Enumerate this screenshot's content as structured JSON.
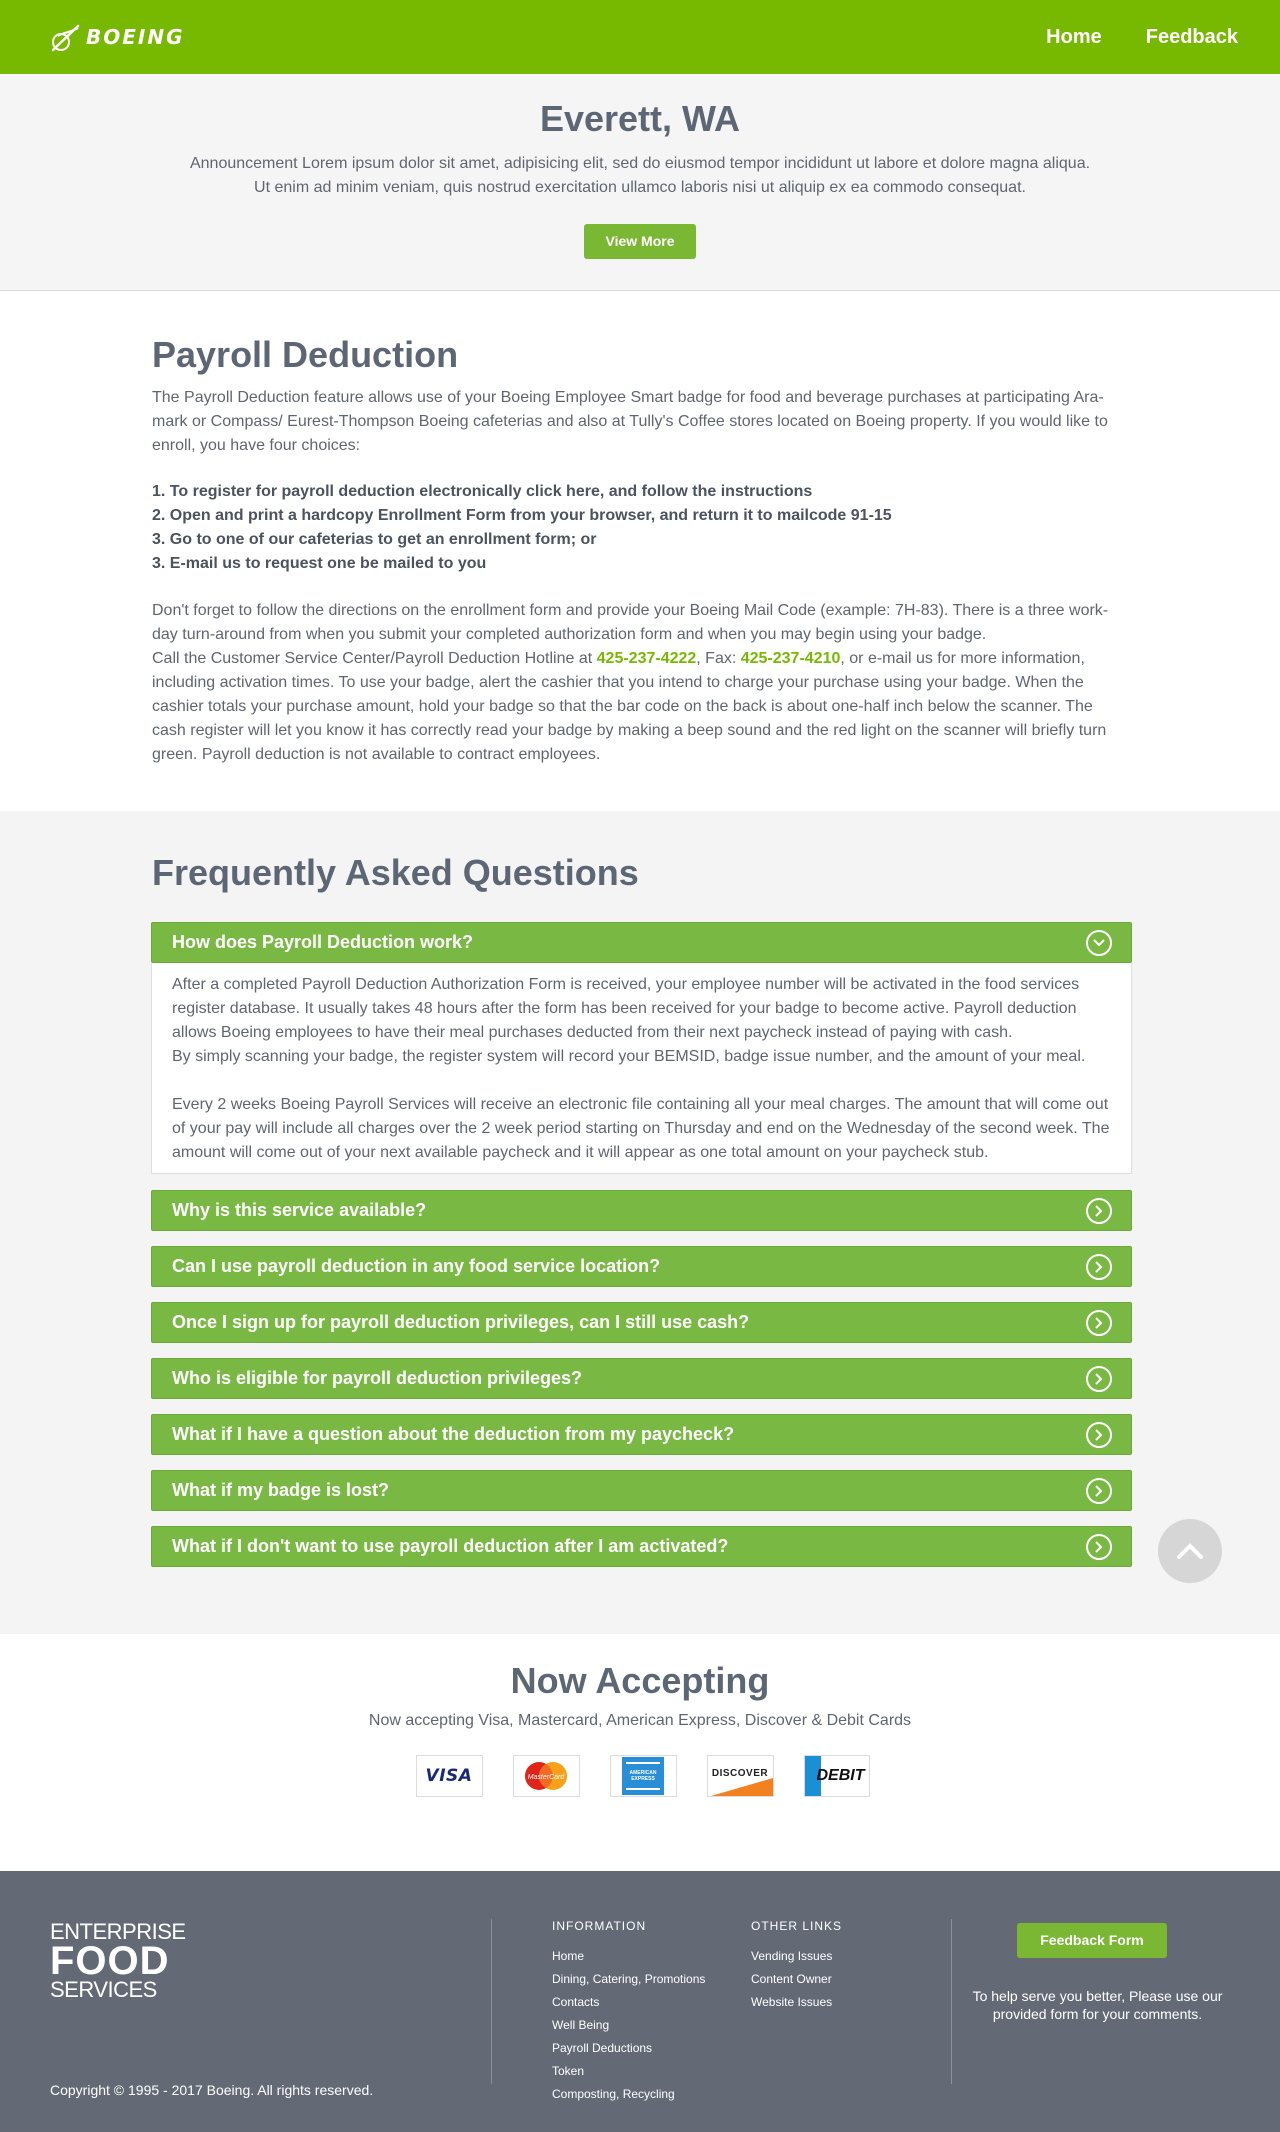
{
  "header": {
    "logo_text": "BOEING",
    "nav": [
      {
        "label": "Home"
      },
      {
        "label": "Feedback"
      }
    ]
  },
  "announcement": {
    "title": "Everett, WA",
    "line1": "Announcement Lorem ipsum dolor sit amet, adipisicing elit, sed do eiusmod tempor incididunt ut labore et dolore magna aliqua.",
    "line2": "Ut enim ad minim veniam, quis nostrud exercitation ullamco laboris nisi ut aliquip ex ea commodo consequat.",
    "button": "View More"
  },
  "payroll": {
    "title": "Payroll Deduction",
    "intro": "The Payroll Deduction feature allows use of your Boeing Employee Smart badge for food and beverage purchases at participating Ara- mark or Compass/ Eurest-Thompson Boeing cafeterias and also at Tully's Coffee stores located on Boeing property. If you would like to enroll, you have four choices:",
    "choices": [
      "1. To register for payroll deduction electronically click here, and follow the instructions",
      "2. Open and print a hardcopy Enrollment Form from your browser, and return it to mailcode 91-15",
      "3. Go to one of our cafeterias to get an enrollment form; or",
      "3. E-mail us to request one be mailed to you"
    ],
    "para2": "Don't forget to follow the directions on the enrollment form and provide your Boeing Mail Code (example: 7H-83). There is a three work-day turn-around from when you submit your completed authorization form and when you may begin using your badge.",
    "call_prefix": "Call the Customer Service Center/Payroll Deduction Hotline at ",
    "phone": "425-237-4222",
    "fax_prefix": ", Fax: ",
    "fax": "425-237-4210",
    "call_suffix": ", or e-mail us for more information, including activation times. To use your badge, alert the cashier that you intend to charge your purchase using your badge. When the cashier totals your purchase amount, hold your badge so that the bar code on the back is about one-half inch below the scanner. The cash register will let you know it has correctly read your badge by making a beep sound and the red light on the scanner will briefly turn green. Payroll deduction is not available to contract employees."
  },
  "faq": {
    "title": "Frequently Asked Questions",
    "open_item": {
      "question": "How does Payroll Deduction work?",
      "answer_p1": "After a completed Payroll Deduction Authorization Form is received, your employee number will be activated in the food services register database. It usually takes 48 hours after the form has been received for your badge to become active. Payroll deduction allows Boeing employees to have their meal purchases deducted from their next paycheck instead of paying with cash.",
      "answer_p2": "By simply scanning your badge, the register system will record your BEMSID, badge issue number, and the amount of your meal.",
      "answer_p3": "Every 2 weeks Boeing Payroll Services will receive an electronic file containing all your meal charges. The amount that will come out of your pay will include all charges over the 2 week period starting on Thursday and end on the Wednesday of the second week. The amount will come out of your next available paycheck and it will appear as one total amount on your paycheck stub."
    },
    "items": [
      {
        "question": "Why is this service available?"
      },
      {
        "question": "Can I use payroll deduction in any food service location?"
      },
      {
        "question": "Once I sign up for payroll deduction privileges, can I still use cash?"
      },
      {
        "question": "Who is eligible for payroll deduction privileges?"
      },
      {
        "question": "What if I have a question about the deduction from my paycheck?"
      },
      {
        "question": "What if my badge is lost?"
      },
      {
        "question": "What if I don't want to use payroll deduction after I am activated?"
      }
    ]
  },
  "accepting": {
    "title": "Now Accepting",
    "subtitle": "Now accepting Visa, Mastercard, American Express, Discover & Debit Cards",
    "cards": {
      "visa": "VISA",
      "mastercard": "MasterCard",
      "amex": "AMERICAN EXPRESS",
      "discover": "DISCOVER",
      "debit": "DEBIT"
    }
  },
  "footer": {
    "brand_line1": "ENTERPRISE",
    "brand_line2": "FOOD",
    "brand_line3": "SERVICES",
    "copyright": "Copyright © 1995 - 2017 Boeing. All rights reserved.",
    "info_title": "INFORMATION",
    "info_links": [
      "Home",
      "Dining, Catering, Promotions",
      "Contacts",
      "Well Being",
      "Payroll Deductions",
      "Token",
      "Composting, Recycling"
    ],
    "other_title": "OTHER LINKS",
    "other_links": [
      "Vending Issues",
      "Content Owner",
      "Website Issues"
    ],
    "feedback_button": "Feedback Form",
    "help_text": "To help serve you better, Please use our provided form for your comments."
  },
  "colors": {
    "brand_green": "#77b800",
    "accordion_green": "#7ab844",
    "heading_gray": "#5d6674",
    "footer_bg": "#636a75"
  }
}
